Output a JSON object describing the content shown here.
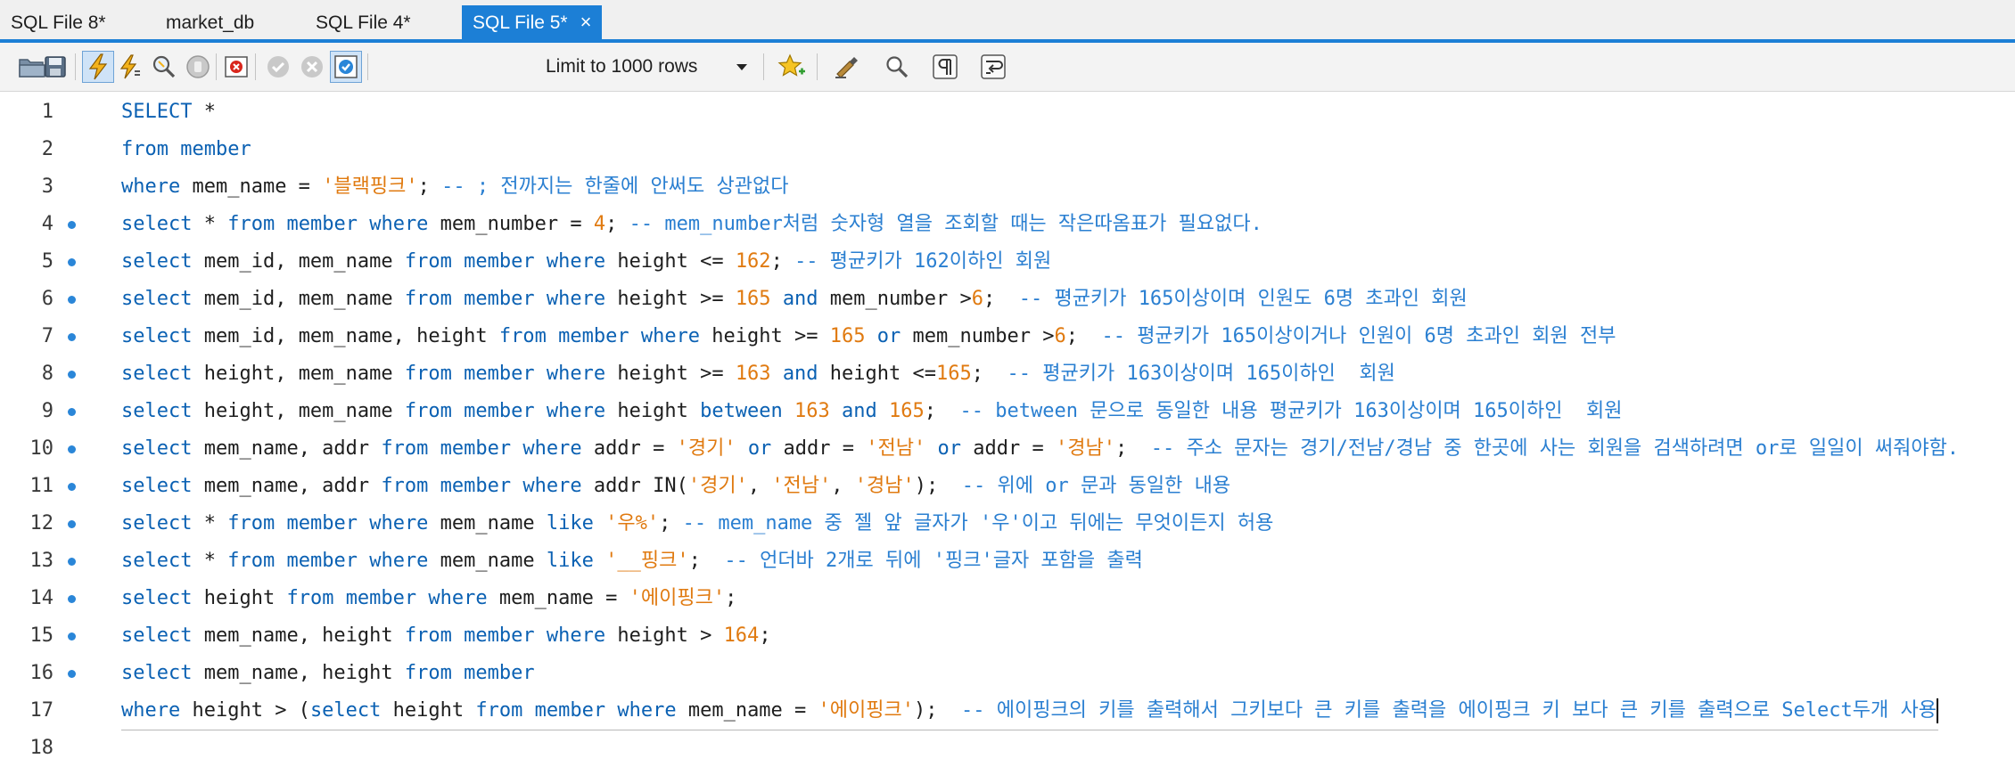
{
  "tabs": [
    {
      "label": "SQL File 8*",
      "active": false
    },
    {
      "label": "market_db",
      "active": false
    },
    {
      "label": "SQL File 4*",
      "active": false
    },
    {
      "label": "SQL File 5*",
      "active": true
    }
  ],
  "tab_close": "×",
  "toolbar": {
    "limit_select": "Limit to 1000 rows"
  },
  "colors": {
    "keyword": "#0b61b3",
    "string": "#e07a10",
    "number": "#e07a10",
    "comment": "#2a7fd1",
    "accent": "#1c7fd6"
  },
  "editor": {
    "lines": [
      {
        "n": "1",
        "dot": false,
        "tokens": [
          [
            "k",
            "SELECT"
          ],
          [
            "t",
            " *"
          ]
        ]
      },
      {
        "n": "2",
        "dot": false,
        "tokens": [
          [
            "k",
            "from"
          ],
          [
            "t",
            " "
          ],
          [
            "k",
            "member"
          ]
        ]
      },
      {
        "n": "3",
        "dot": false,
        "tokens": [
          [
            "k",
            "where"
          ],
          [
            "t",
            " mem_name = "
          ],
          [
            "s",
            "'블랙핑크'"
          ],
          [
            "t",
            "; "
          ],
          [
            "c",
            "-- ; 전까지는 한줄에 안써도 상관없다"
          ]
        ]
      },
      {
        "n": "4",
        "dot": true,
        "tokens": [
          [
            "k",
            "select"
          ],
          [
            "t",
            " * "
          ],
          [
            "k",
            "from"
          ],
          [
            "t",
            " "
          ],
          [
            "k",
            "member"
          ],
          [
            "t",
            " "
          ],
          [
            "k",
            "where"
          ],
          [
            "t",
            " mem_number = "
          ],
          [
            "n",
            "4"
          ],
          [
            "t",
            "; "
          ],
          [
            "c",
            "-- mem_number처럼 숫자형 열을 조회할 때는 작은따옴표가 필요없다."
          ]
        ]
      },
      {
        "n": "5",
        "dot": true,
        "tokens": [
          [
            "k",
            "select"
          ],
          [
            "t",
            " mem_id, mem_name "
          ],
          [
            "k",
            "from"
          ],
          [
            "t",
            " "
          ],
          [
            "k",
            "member"
          ],
          [
            "t",
            " "
          ],
          [
            "k",
            "where"
          ],
          [
            "t",
            " height <= "
          ],
          [
            "n",
            "162"
          ],
          [
            "t",
            "; "
          ],
          [
            "c",
            "-- 평균키가 162이하인 회원"
          ]
        ]
      },
      {
        "n": "6",
        "dot": true,
        "tokens": [
          [
            "k",
            "select"
          ],
          [
            "t",
            " mem_id, mem_name "
          ],
          [
            "k",
            "from"
          ],
          [
            "t",
            " "
          ],
          [
            "k",
            "member"
          ],
          [
            "t",
            " "
          ],
          [
            "k",
            "where"
          ],
          [
            "t",
            " height >= "
          ],
          [
            "n",
            "165"
          ],
          [
            "t",
            " "
          ],
          [
            "k",
            "and"
          ],
          [
            "t",
            " mem_number >"
          ],
          [
            "n",
            "6"
          ],
          [
            "t",
            ";  "
          ],
          [
            "c",
            "-- 평균키가 165이상이며 인원도 6명 초과인 회원"
          ]
        ]
      },
      {
        "n": "7",
        "dot": true,
        "tokens": [
          [
            "k",
            "select"
          ],
          [
            "t",
            " mem_id, mem_name, height "
          ],
          [
            "k",
            "from"
          ],
          [
            "t",
            " "
          ],
          [
            "k",
            "member"
          ],
          [
            "t",
            " "
          ],
          [
            "k",
            "where"
          ],
          [
            "t",
            " height >= "
          ],
          [
            "n",
            "165"
          ],
          [
            "t",
            " "
          ],
          [
            "k",
            "or"
          ],
          [
            "t",
            " mem_number >"
          ],
          [
            "n",
            "6"
          ],
          [
            "t",
            ";  "
          ],
          [
            "c",
            "-- 평균키가 165이상이거나 인원이 6명 초과인 회원 전부"
          ]
        ]
      },
      {
        "n": "8",
        "dot": true,
        "tokens": [
          [
            "k",
            "select"
          ],
          [
            "t",
            " height, mem_name "
          ],
          [
            "k",
            "from"
          ],
          [
            "t",
            " "
          ],
          [
            "k",
            "member"
          ],
          [
            "t",
            " "
          ],
          [
            "k",
            "where"
          ],
          [
            "t",
            " height >= "
          ],
          [
            "n",
            "163"
          ],
          [
            "t",
            " "
          ],
          [
            "k",
            "and"
          ],
          [
            "t",
            " height <="
          ],
          [
            "n",
            "165"
          ],
          [
            "t",
            ";  "
          ],
          [
            "c",
            "-- 평균키가 163이상이며 165이하인  회원"
          ]
        ]
      },
      {
        "n": "9",
        "dot": true,
        "tokens": [
          [
            "k",
            "select"
          ],
          [
            "t",
            " height, mem_name "
          ],
          [
            "k",
            "from"
          ],
          [
            "t",
            " "
          ],
          [
            "k",
            "member"
          ],
          [
            "t",
            " "
          ],
          [
            "k",
            "where"
          ],
          [
            "t",
            " height "
          ],
          [
            "k",
            "between"
          ],
          [
            "t",
            " "
          ],
          [
            "n",
            "163"
          ],
          [
            "t",
            " "
          ],
          [
            "k",
            "and"
          ],
          [
            "t",
            " "
          ],
          [
            "n",
            "165"
          ],
          [
            "t",
            ";  "
          ],
          [
            "c",
            "-- between 문으로 동일한 내용 평균키가 163이상이며 165이하인  회원"
          ]
        ]
      },
      {
        "n": "10",
        "dot": true,
        "tokens": [
          [
            "k",
            "select"
          ],
          [
            "t",
            " mem_name, addr "
          ],
          [
            "k",
            "from"
          ],
          [
            "t",
            " "
          ],
          [
            "k",
            "member"
          ],
          [
            "t",
            " "
          ],
          [
            "k",
            "where"
          ],
          [
            "t",
            " addr = "
          ],
          [
            "s",
            "'경기'"
          ],
          [
            "t",
            " "
          ],
          [
            "k",
            "or"
          ],
          [
            "t",
            " addr = "
          ],
          [
            "s",
            "'전남'"
          ],
          [
            "t",
            " "
          ],
          [
            "k",
            "or"
          ],
          [
            "t",
            " addr = "
          ],
          [
            "s",
            "'경남'"
          ],
          [
            "t",
            ";  "
          ],
          [
            "c",
            "-- 주소 문자는 경기/전남/경남 중 한곳에 사는 회원을 검색하려면 or로 일일이 써줘야함."
          ]
        ]
      },
      {
        "n": "11",
        "dot": true,
        "tokens": [
          [
            "k",
            "select"
          ],
          [
            "t",
            " mem_name, addr "
          ],
          [
            "k",
            "from"
          ],
          [
            "t",
            " "
          ],
          [
            "k",
            "member"
          ],
          [
            "t",
            " "
          ],
          [
            "k",
            "where"
          ],
          [
            "t",
            " addr IN("
          ],
          [
            "s",
            "'경기'"
          ],
          [
            "t",
            ", "
          ],
          [
            "s",
            "'전남'"
          ],
          [
            "t",
            ", "
          ],
          [
            "s",
            "'경남'"
          ],
          [
            "t",
            ");  "
          ],
          [
            "c",
            "-- 위에 or 문과 동일한 내용"
          ]
        ]
      },
      {
        "n": "12",
        "dot": true,
        "tokens": [
          [
            "k",
            "select"
          ],
          [
            "t",
            " * "
          ],
          [
            "k",
            "from"
          ],
          [
            "t",
            " "
          ],
          [
            "k",
            "member"
          ],
          [
            "t",
            " "
          ],
          [
            "k",
            "where"
          ],
          [
            "t",
            " mem_name "
          ],
          [
            "k",
            "like"
          ],
          [
            "t",
            " "
          ],
          [
            "s",
            "'우%'"
          ],
          [
            "t",
            "; "
          ],
          [
            "c",
            "-- mem_name 중 젤 앞 글자가 '우'이고 뒤에는 무엇이든지 허용"
          ]
        ]
      },
      {
        "n": "13",
        "dot": true,
        "tokens": [
          [
            "k",
            "select"
          ],
          [
            "t",
            " * "
          ],
          [
            "k",
            "from"
          ],
          [
            "t",
            " "
          ],
          [
            "k",
            "member"
          ],
          [
            "t",
            " "
          ],
          [
            "k",
            "where"
          ],
          [
            "t",
            " mem_name "
          ],
          [
            "k",
            "like"
          ],
          [
            "t",
            " "
          ],
          [
            "s",
            "'__핑크'"
          ],
          [
            "t",
            ";  "
          ],
          [
            "c",
            "-- 언더바 2개로 뒤에 '핑크'글자 포함을 출력"
          ]
        ]
      },
      {
        "n": "14",
        "dot": true,
        "tokens": [
          [
            "k",
            "select"
          ],
          [
            "t",
            " height "
          ],
          [
            "k",
            "from"
          ],
          [
            "t",
            " "
          ],
          [
            "k",
            "member"
          ],
          [
            "t",
            " "
          ],
          [
            "k",
            "where"
          ],
          [
            "t",
            " mem_name = "
          ],
          [
            "s",
            "'에이핑크'"
          ],
          [
            "t",
            ";"
          ]
        ]
      },
      {
        "n": "15",
        "dot": true,
        "tokens": [
          [
            "k",
            "select"
          ],
          [
            "t",
            " mem_name, height "
          ],
          [
            "k",
            "from"
          ],
          [
            "t",
            " "
          ],
          [
            "k",
            "member"
          ],
          [
            "t",
            " "
          ],
          [
            "k",
            "where"
          ],
          [
            "t",
            " height > "
          ],
          [
            "n",
            "164"
          ],
          [
            "t",
            ";"
          ]
        ]
      },
      {
        "n": "16",
        "dot": true,
        "tokens": [
          [
            "k",
            "select"
          ],
          [
            "t",
            " mem_name, height "
          ],
          [
            "k",
            "from"
          ],
          [
            "t",
            " "
          ],
          [
            "k",
            "member"
          ]
        ]
      },
      {
        "n": "17",
        "dot": false,
        "current": true,
        "tokens": [
          [
            "k",
            "where"
          ],
          [
            "t",
            " height > ("
          ],
          [
            "k",
            "select"
          ],
          [
            "t",
            " height "
          ],
          [
            "k",
            "from"
          ],
          [
            "t",
            " "
          ],
          [
            "k",
            "member"
          ],
          [
            "t",
            " "
          ],
          [
            "k",
            "where"
          ],
          [
            "t",
            " mem_name = "
          ],
          [
            "s",
            "'에이핑크'"
          ],
          [
            "t",
            ");  "
          ],
          [
            "c",
            "-- 에이핑크의 키를 출력해서 그키보다 큰 키를 출력을 에이핑크 키 보다 큰 키를 출력으로 Select두개 사용"
          ]
        ]
      },
      {
        "n": "18",
        "dot": false,
        "tokens": []
      }
    ]
  }
}
